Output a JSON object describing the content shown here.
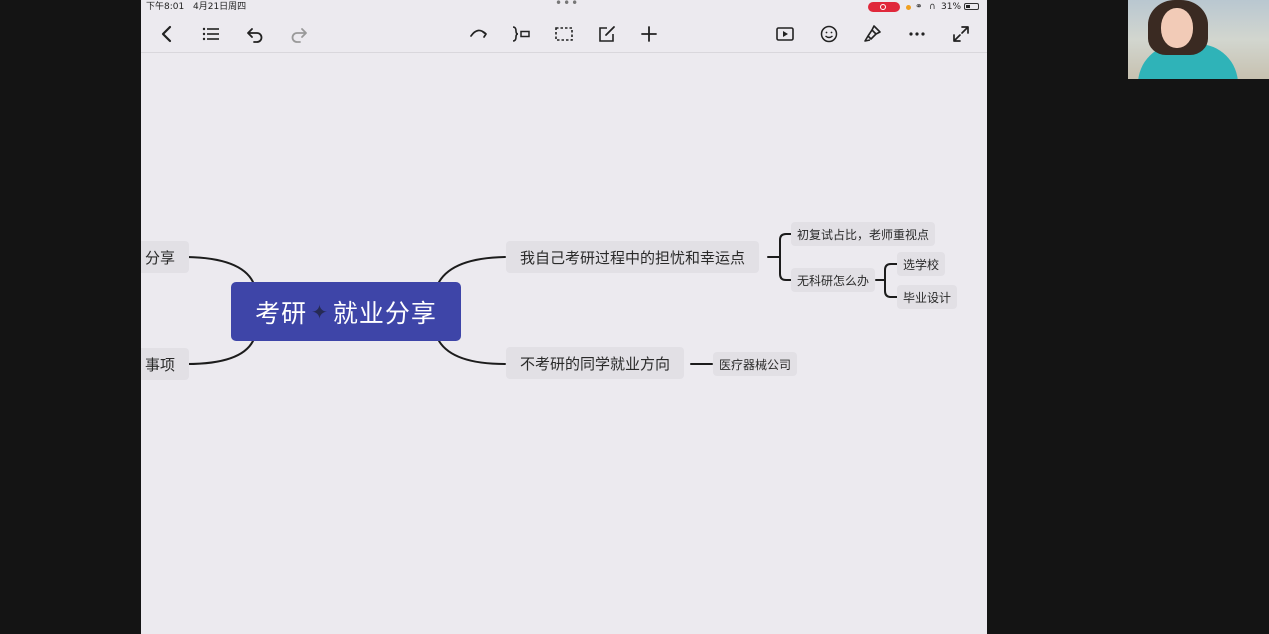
{
  "status_bar": {
    "time": "下午8:01",
    "date": "4月21日周四",
    "battery": "31%",
    "recording_color": "#e0283b"
  },
  "toolbar": {
    "left_icons": [
      "chevron-left-icon",
      "outline-list-icon",
      "undo-icon",
      "redo-icon"
    ],
    "center_icons": [
      "relationship-icon",
      "boundary-icon",
      "summary-icon",
      "note-icon",
      "add-icon"
    ],
    "right_icons": [
      "play-icon",
      "emoji-icon",
      "format-painter-icon",
      "more-icon",
      "fullscreen-icon"
    ]
  },
  "mindmap": {
    "central_topic_left": "考研",
    "central_topic_right": "就业分享",
    "central_color": "#3e45a8",
    "left_branches": [
      {
        "label": "分享"
      },
      {
        "label": "事项"
      }
    ],
    "right_branches": [
      {
        "label": "我自己考研过程中的担忧和幸运点",
        "children": [
          {
            "label": "初复试占比，老师重视点"
          },
          {
            "label": "无科研怎么办",
            "children": [
              {
                "label": "选学校"
              },
              {
                "label": "毕业设计"
              }
            ]
          }
        ]
      },
      {
        "label": "不考研的同学就业方向",
        "children": [
          {
            "label": "医疗器械公司"
          }
        ]
      }
    ]
  }
}
